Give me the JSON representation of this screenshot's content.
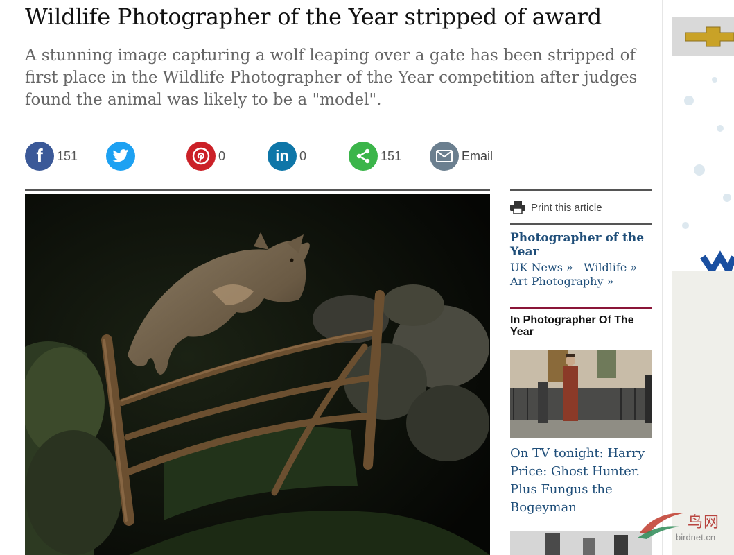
{
  "article": {
    "headline": "Wildlife Photographer of the Year stripped of award",
    "standfirst": "A stunning image capturing a wolf leaping over a gate has been stripped of first place in the Wildlife Photographer of the Year competition after judges found the animal was likely to be a \"model\"."
  },
  "share": {
    "facebook": {
      "icon": "f",
      "count": "151",
      "color": "#3b5998"
    },
    "twitter": {
      "icon": "twitter-bird",
      "color": "#1da1f2"
    },
    "pinterest": {
      "icon": "p",
      "count": "0",
      "color": "#cb2027"
    },
    "linkedin": {
      "icon": "in",
      "count": "0",
      "color": "#0e76a8"
    },
    "sharethis": {
      "icon": "share-nodes",
      "count": "151",
      "color": "#3bb54a"
    },
    "email": {
      "icon": "envelope",
      "label": "Email",
      "color": "#6b7f8f"
    }
  },
  "sidebar": {
    "print_label": "Print this article",
    "topic_title": "Photographer of the Year",
    "topic_links": [
      "UK News »",
      "Wildlife »",
      "Art Photography »"
    ],
    "in_section_title": "In Photographer Of The Year",
    "related_caption": "On TV tonight: Harry Price: Ghost Hunter. Plus Fungus the Bogeyman"
  },
  "watermark": {
    "cn_text": "鸟网",
    "url": "birdnet.cn"
  }
}
